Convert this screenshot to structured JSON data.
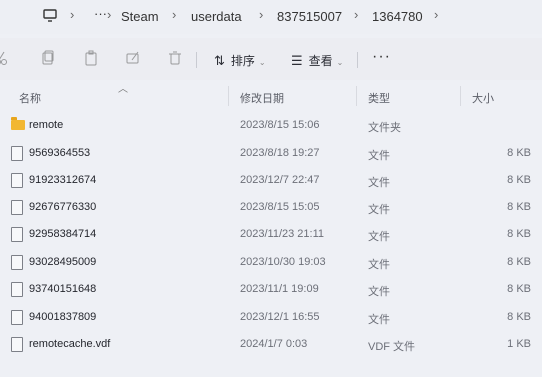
{
  "address": {
    "crumbs": [
      "Steam",
      "userdata",
      "837515007",
      "1364780"
    ],
    "more": "···"
  },
  "toolbar": {
    "sort_label": "排序",
    "view_label": "查看",
    "more": "···"
  },
  "columns": {
    "name": "名称",
    "modified": "修改日期",
    "type": "类型",
    "size": "大小"
  },
  "files": [
    {
      "name": "remote",
      "modified": "2023/8/15 15:06",
      "type": "文件夹",
      "size": "",
      "kind": "folder"
    },
    {
      "name": "9569364553",
      "modified": "2023/8/18 19:27",
      "type": "文件",
      "size": "8 KB",
      "kind": "file"
    },
    {
      "name": "91923312674",
      "modified": "2023/12/7 22:47",
      "type": "文件",
      "size": "8 KB",
      "kind": "file"
    },
    {
      "name": "92676776330",
      "modified": "2023/8/15 15:05",
      "type": "文件",
      "size": "8 KB",
      "kind": "file"
    },
    {
      "name": "92958384714",
      "modified": "2023/11/23 21:11",
      "type": "文件",
      "size": "8 KB",
      "kind": "file"
    },
    {
      "name": "93028495009",
      "modified": "2023/10/30 19:03",
      "type": "文件",
      "size": "8 KB",
      "kind": "file"
    },
    {
      "name": "93740151648",
      "modified": "2023/11/1 19:09",
      "type": "文件",
      "size": "8 KB",
      "kind": "file"
    },
    {
      "name": "94001837809",
      "modified": "2023/12/1 16:55",
      "type": "文件",
      "size": "8 KB",
      "kind": "file"
    },
    {
      "name": "remotecache.vdf",
      "modified": "2024/1/7 0:03",
      "type": "VDF 文件",
      "size": "1 KB",
      "kind": "file"
    }
  ]
}
